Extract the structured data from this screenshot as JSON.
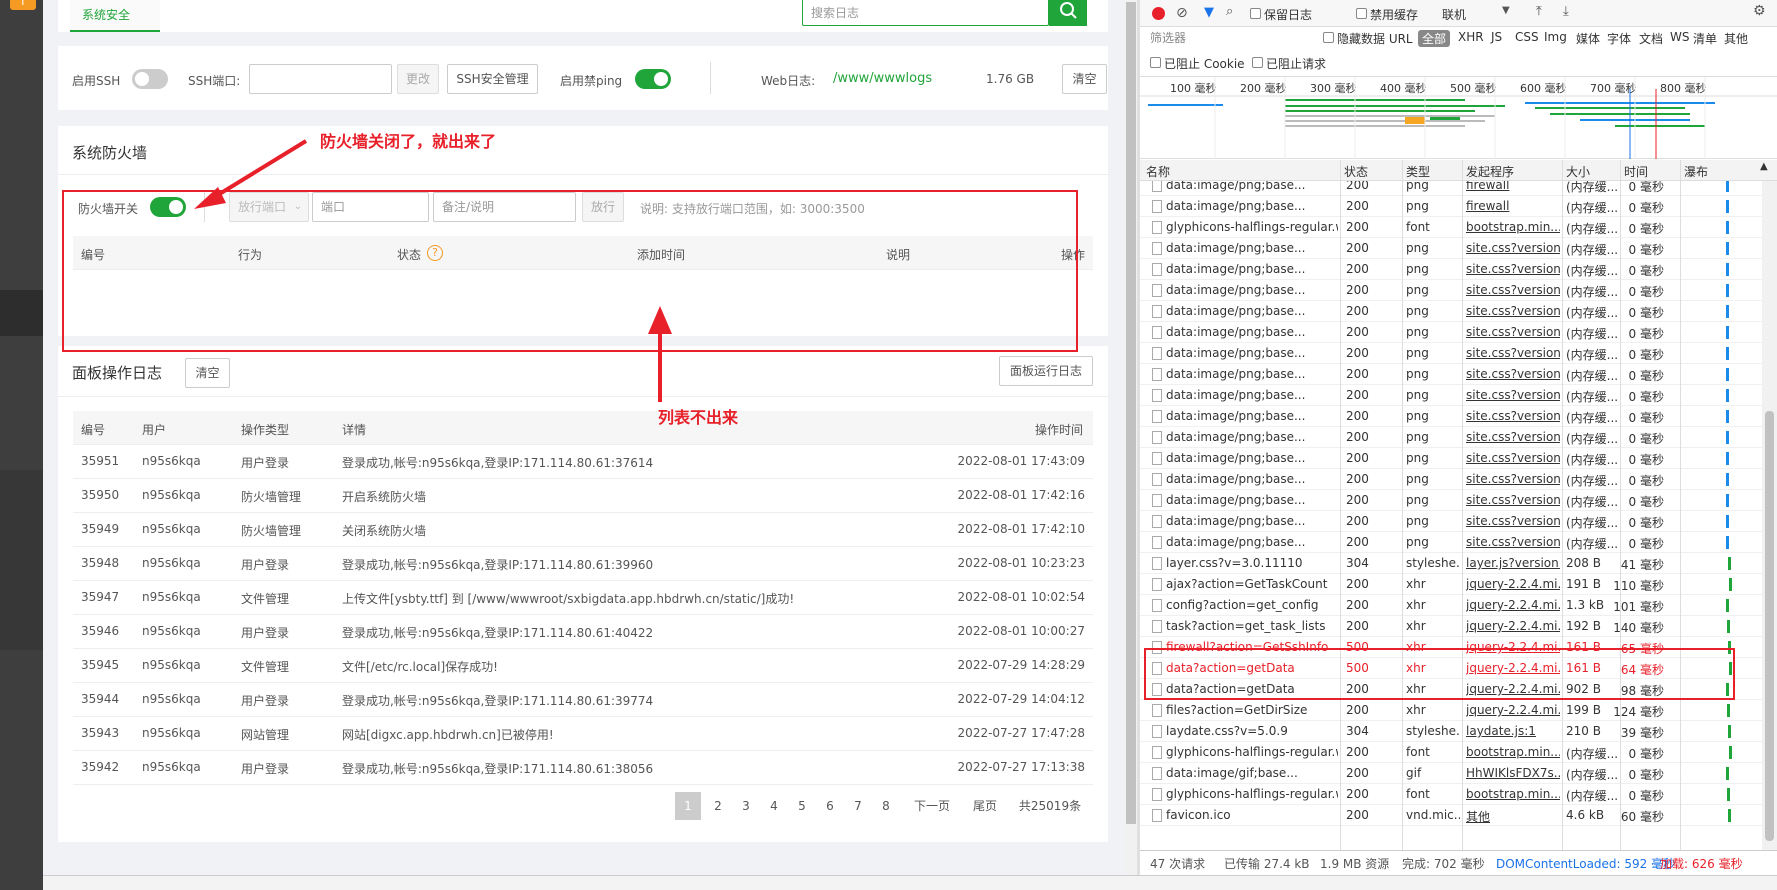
{
  "sidebar": {
    "logo": "f"
  },
  "tab": {
    "label": "系统安全"
  },
  "log_search": {
    "placeholder": "搜索日志"
  },
  "settings": {
    "ssh_label": "启用SSH",
    "ssh_port_label": "SSH端口:",
    "change": "更改",
    "ssh_manage": "SSH安全管理",
    "ping_label": "启用禁ping",
    "weblog_label": "Web日志:",
    "weblog_path": "/www/wwwlogs",
    "weblog_size": "1.76 GB",
    "clear": "清空"
  },
  "firewall": {
    "title": "系统防火墙",
    "switch_label": "防火墙开关",
    "port_select": "放行端口",
    "port_placeholder": "端口",
    "note_placeholder": "备注/说明",
    "allow": "放行",
    "hint": "说明: 支持放行端口范围，如: 3000:3500",
    "columns": [
      "编号",
      "行为",
      "状态",
      "添加时间",
      "说明",
      "操作"
    ],
    "help": "?"
  },
  "annotations": {
    "top": "防火墙关闭了，就出来了",
    "bottom": "列表不出来"
  },
  "logs": {
    "title": "面板操作日志",
    "clear": "清空",
    "run_log": "面板运行日志",
    "columns": [
      "编号",
      "用户",
      "操作类型",
      "详情",
      "操作时间"
    ],
    "rows": [
      [
        "35951",
        "n95s6kqa",
        "用户登录",
        "登录成功,帐号:n95s6kqa,登录IP:171.114.80.61:37614",
        "2022-08-01 17:43:09"
      ],
      [
        "35950",
        "n95s6kqa",
        "防火墙管理",
        "开启系统防火墙",
        "2022-08-01 17:42:16"
      ],
      [
        "35949",
        "n95s6kqa",
        "防火墙管理",
        "关闭系统防火墙",
        "2022-08-01 17:42:10"
      ],
      [
        "35948",
        "n95s6kqa",
        "用户登录",
        "登录成功,帐号:n95s6kqa,登录IP:171.114.80.61:39960",
        "2022-08-01 10:23:23"
      ],
      [
        "35947",
        "n95s6kqa",
        "文件管理",
        "上传文件[ysbty.ttf] 到 [/www/wwwroot/sxbigdata.app.hbdrwh.cn/static/]成功!",
        "2022-08-01 10:02:54"
      ],
      [
        "35946",
        "n95s6kqa",
        "用户登录",
        "登录成功,帐号:n95s6kqa,登录IP:171.114.80.61:40422",
        "2022-08-01 10:00:27"
      ],
      [
        "35945",
        "n95s6kqa",
        "文件管理",
        "文件[/etc/rc.local]保存成功!",
        "2022-07-29 14:28:29"
      ],
      [
        "35944",
        "n95s6kqa",
        "用户登录",
        "登录成功,帐号:n95s6kqa,登录IP:171.114.80.61:39774",
        "2022-07-29 14:04:12"
      ],
      [
        "35943",
        "n95s6kqa",
        "网站管理",
        "网站[digxc.app.hbdrwh.cn]已被停用!",
        "2022-07-27 17:47:28"
      ],
      [
        "35942",
        "n95s6kqa",
        "用户登录",
        "登录成功,帐号:n95s6kqa,登录IP:171.114.80.61:38056",
        "2022-07-27 17:13:38"
      ]
    ],
    "pages": [
      "1",
      "2",
      "3",
      "4",
      "5",
      "6",
      "7",
      "8"
    ],
    "next": "下一页",
    "last": "尾页",
    "total": "共25019条"
  },
  "devtools": {
    "toolbar": {
      "preserve_log": "保留日志",
      "disable_cache": "禁用缓存",
      "throttle": "联机"
    },
    "filter": {
      "placeholder": "筛选器",
      "hide_data_urls": "隐藏数据 URL",
      "all": "全部",
      "types": [
        "XHR",
        "JS",
        "CSS",
        "Img",
        "媒体",
        "字体",
        "文档",
        "WS",
        "清单",
        "其他"
      ],
      "blocked_cookies": "已阻止 Cookie",
      "blocked_requests": "已阻止请求"
    },
    "timeline": [
      "100 毫秒",
      "200 毫秒",
      "300 毫秒",
      "400 毫秒",
      "500 毫秒",
      "600 毫秒",
      "700 毫秒",
      "800 毫秒"
    ],
    "columns": [
      "名称",
      "状态",
      "类型",
      "发起程序",
      "大小",
      "时间",
      "瀑布"
    ],
    "rows": [
      [
        "data:image/png;base...",
        "200",
        "png",
        "firewall",
        "(内存缓...",
        "0 毫秒"
      ],
      [
        "data:image/png;base...",
        "200",
        "png",
        "firewall",
        "(内存缓...",
        "0 毫秒"
      ],
      [
        "glyphicons-halflings-regular.w...",
        "200",
        "font",
        "bootstrap.min....",
        "(内存缓...",
        "0 毫秒"
      ],
      [
        "data:image/png;base...",
        "200",
        "png",
        "site.css?version...",
        "(内存缓...",
        "0 毫秒"
      ],
      [
        "data:image/png;base...",
        "200",
        "png",
        "site.css?version...",
        "(内存缓...",
        "0 毫秒"
      ],
      [
        "data:image/png;base...",
        "200",
        "png",
        "site.css?version...",
        "(内存缓...",
        "0 毫秒"
      ],
      [
        "data:image/png;base...",
        "200",
        "png",
        "site.css?version...",
        "(内存缓...",
        "0 毫秒"
      ],
      [
        "data:image/png;base...",
        "200",
        "png",
        "site.css?version...",
        "(内存缓...",
        "0 毫秒"
      ],
      [
        "data:image/png;base...",
        "200",
        "png",
        "site.css?version...",
        "(内存缓...",
        "0 毫秒"
      ],
      [
        "data:image/png;base...",
        "200",
        "png",
        "site.css?version...",
        "(内存缓...",
        "0 毫秒"
      ],
      [
        "data:image/png;base...",
        "200",
        "png",
        "site.css?version...",
        "(内存缓...",
        "0 毫秒"
      ],
      [
        "data:image/png;base...",
        "200",
        "png",
        "site.css?version...",
        "(内存缓...",
        "0 毫秒"
      ],
      [
        "data:image/png;base...",
        "200",
        "png",
        "site.css?version...",
        "(内存缓...",
        "0 毫秒"
      ],
      [
        "data:image/png;base...",
        "200",
        "png",
        "site.css?version...",
        "(内存缓...",
        "0 毫秒"
      ],
      [
        "data:image/png;base...",
        "200",
        "png",
        "site.css?version...",
        "(内存缓...",
        "0 毫秒"
      ],
      [
        "data:image/png;base...",
        "200",
        "png",
        "site.css?version...",
        "(内存缓...",
        "0 毫秒"
      ],
      [
        "data:image/png;base...",
        "200",
        "png",
        "site.css?version...",
        "(内存缓...",
        "0 毫秒"
      ],
      [
        "data:image/png;base...",
        "200",
        "png",
        "site.css?version...",
        "(内存缓...",
        "0 毫秒"
      ],
      [
        "layer.css?v=3.0.11110",
        "304",
        "styleshe...",
        "layer.js?version...",
        "208 B",
        "41 毫秒"
      ],
      [
        "ajax?action=GetTaskCount",
        "200",
        "xhr",
        "jquery-2.2.4.mi...",
        "191 B",
        "110 毫秒"
      ],
      [
        "config?action=get_config",
        "200",
        "xhr",
        "jquery-2.2.4.mi...",
        "1.3 kB",
        "101 毫秒"
      ],
      [
        "task?action=get_task_lists",
        "200",
        "xhr",
        "jquery-2.2.4.mi...",
        "192 B",
        "140 毫秒"
      ],
      [
        "firewall?action=GetSshInfo",
        "500",
        "xhr",
        "jquery-2.2.4.mi...",
        "161 B",
        "65 毫秒"
      ],
      [
        "data?action=getData",
        "500",
        "xhr",
        "jquery-2.2.4.mi...",
        "161 B",
        "64 毫秒"
      ],
      [
        "data?action=getData",
        "200",
        "xhr",
        "jquery-2.2.4.mi...",
        "902 B",
        "98 毫秒"
      ],
      [
        "files?action=GetDirSize",
        "200",
        "xhr",
        "jquery-2.2.4.mi...",
        "199 B",
        "124 毫秒"
      ],
      [
        "laydate.css?v=5.0.9",
        "304",
        "styleshe...",
        "laydate.js:1",
        "210 B",
        "39 毫秒"
      ],
      [
        "glyphicons-halflings-regular.w...",
        "200",
        "font",
        "bootstrap.min....",
        "(内存缓...",
        "0 毫秒"
      ],
      [
        "data:image/gif;base...",
        "200",
        "gif",
        "HhWIKlsFDX7s...",
        "(内存缓...",
        "0 毫秒"
      ],
      [
        "glyphicons-halflings-regular.w...",
        "200",
        "font",
        "bootstrap.min....",
        "(内存缓...",
        "0 毫秒"
      ],
      [
        "favicon.ico",
        "200",
        "vnd.mic...",
        "其他",
        "4.6 kB",
        "60 毫秒"
      ]
    ],
    "footer": {
      "requests": "47 次请求",
      "transferred": "已传输 27.4 kB",
      "resources": "1.9 MB 资源",
      "finish": "完成: 702 毫秒",
      "dcl": "DOMContentLoaded: 592 毫秒",
      "load": "加载: 626 毫秒"
    }
  },
  "colors": {
    "accent": "#20a53a",
    "error": "#e8202a",
    "link_blue": "#1a73e8"
  }
}
